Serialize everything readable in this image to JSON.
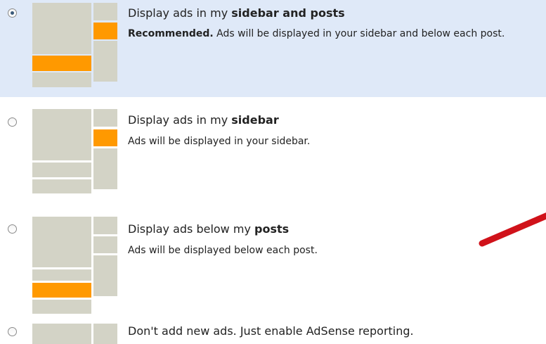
{
  "options": [
    {
      "title_prefix": "Display ads in my ",
      "title_bold": "sidebar and posts",
      "desc_bold": "Recommended.",
      "desc_rest": " Ads will be displayed in your sidebar and below each post.",
      "selected": true
    },
    {
      "title_prefix": "Display ads in my ",
      "title_bold": "sidebar",
      "desc_rest": "Ads will be displayed in your sidebar.",
      "selected": false
    },
    {
      "title_prefix": "Display ads below my ",
      "title_bold": "posts",
      "desc_rest": "Ads will be displayed below each post.",
      "selected": false
    },
    {
      "title_prefix": "Don't add new ads. Just enable AdSense reporting.",
      "selected": false
    }
  ],
  "colors": {
    "selected_bg": "#dfe9f8",
    "ad_orange": "#ff9900",
    "placeholder_gray": "#d3d3c6",
    "arrow_red": "#d0121a"
  }
}
